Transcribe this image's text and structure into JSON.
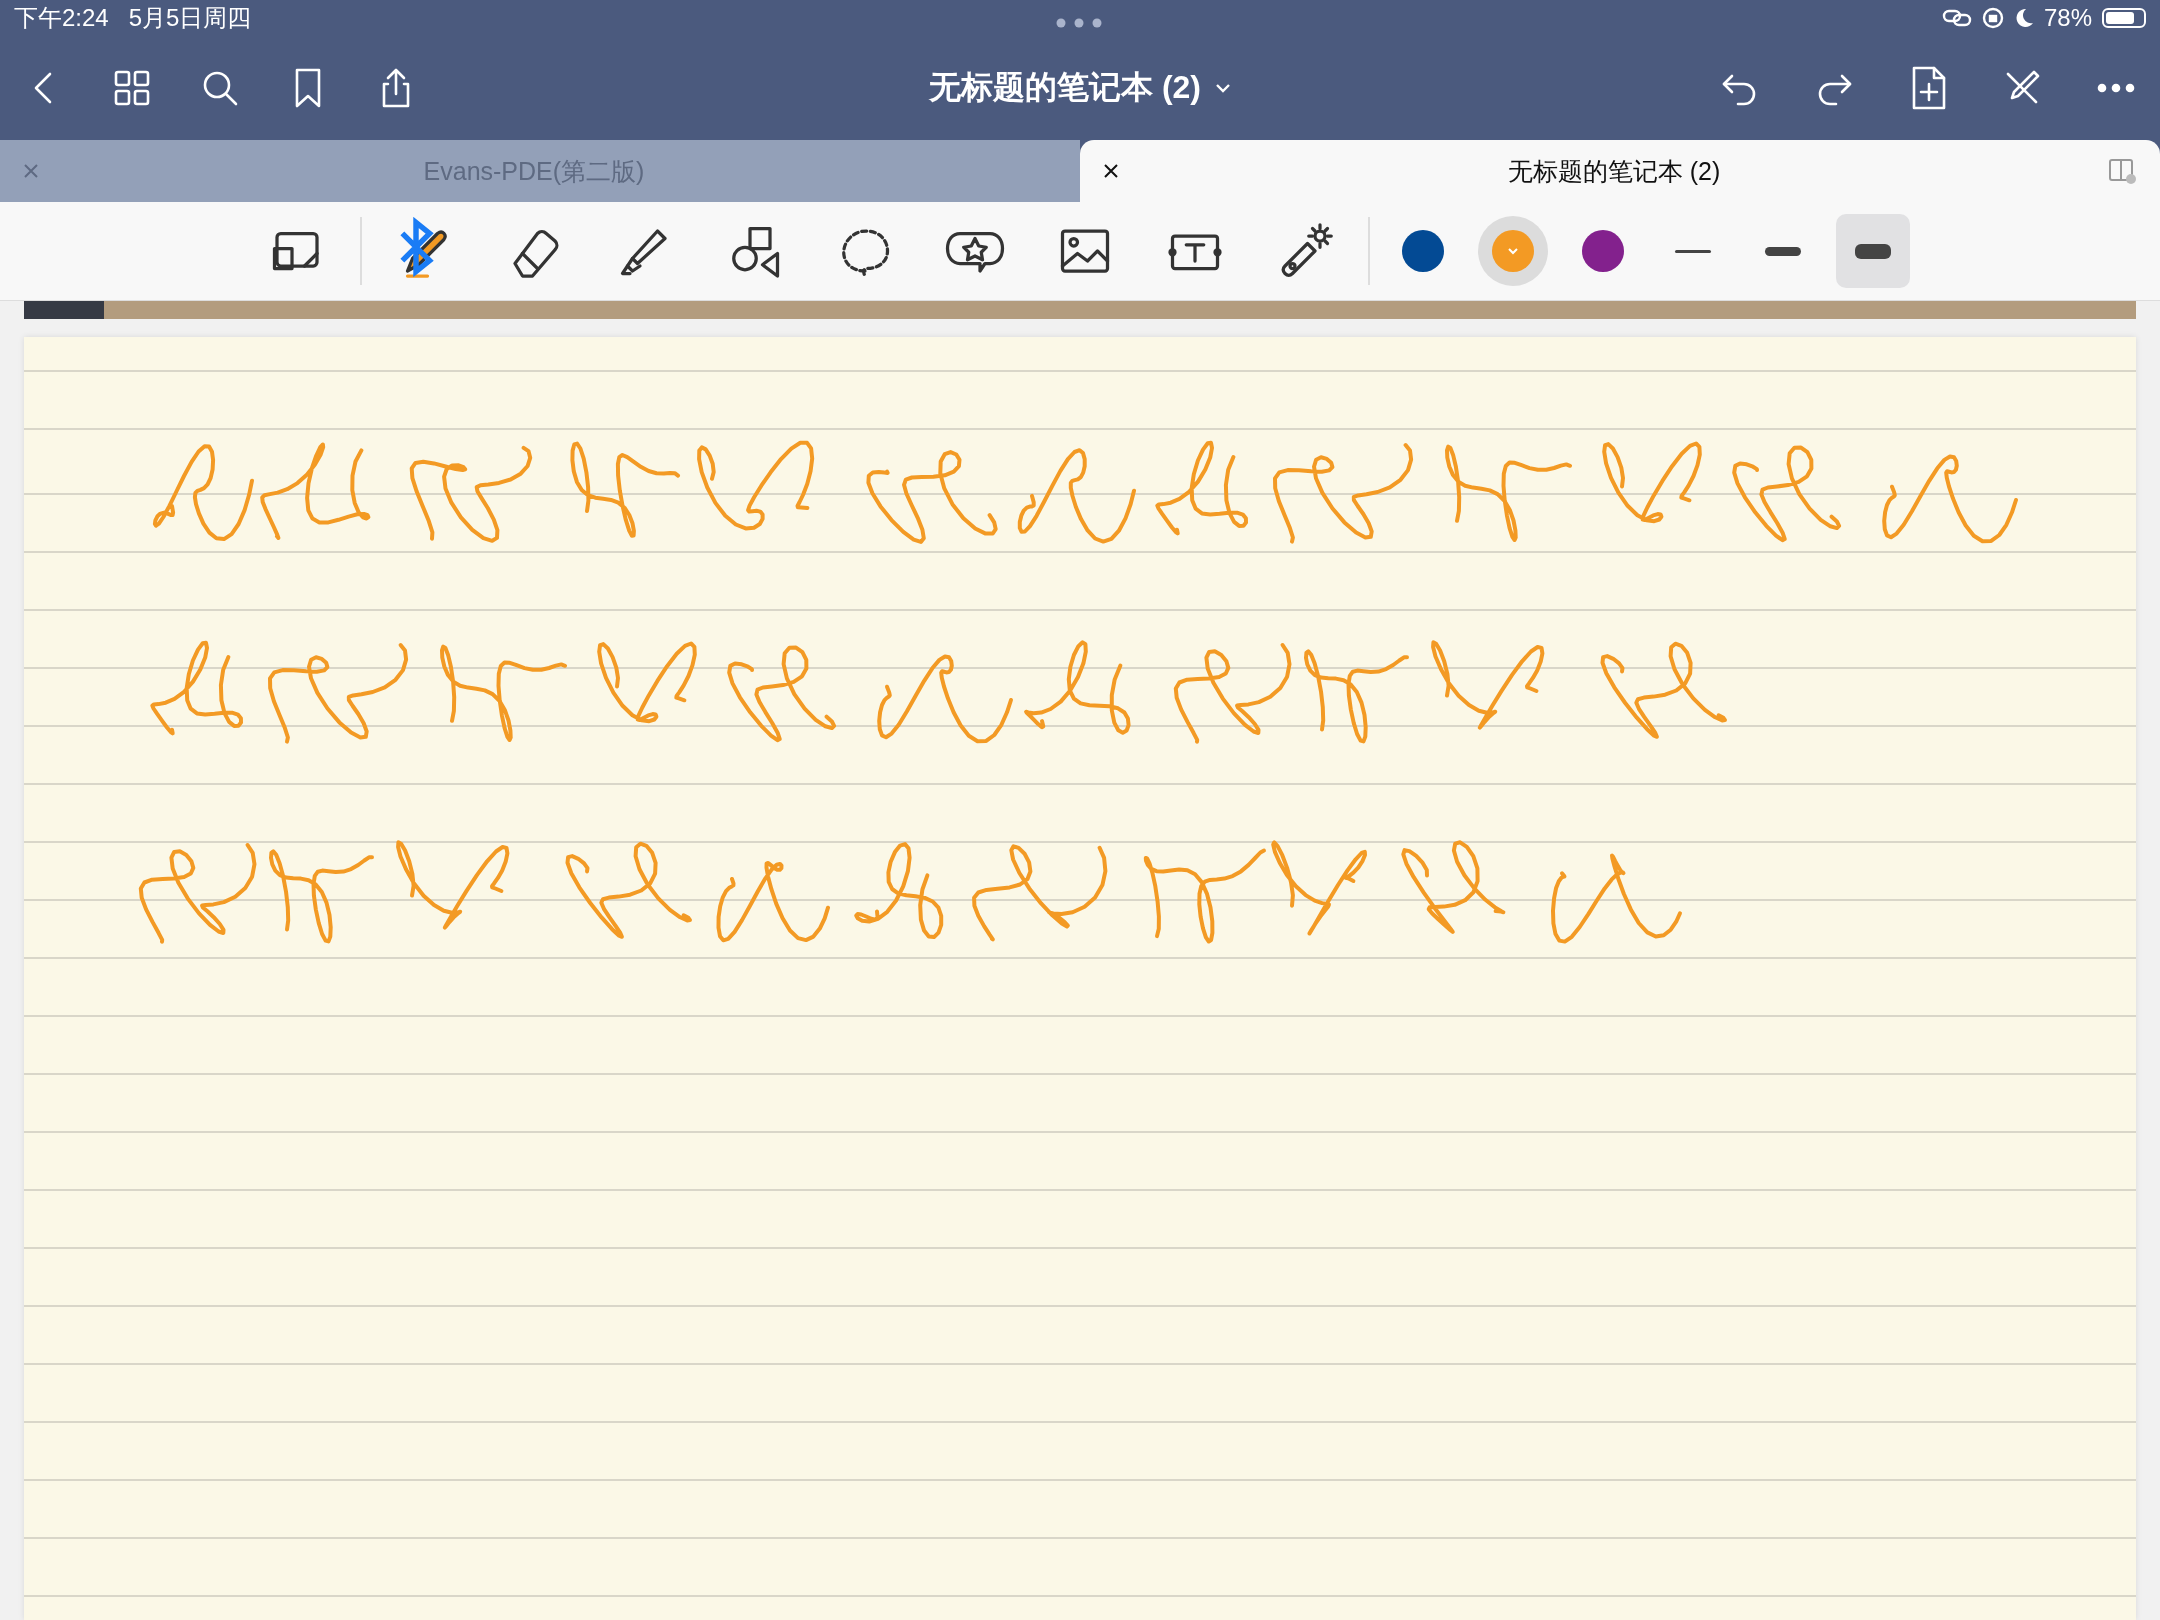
{
  "status_bar": {
    "time": "下午2:24",
    "date": "5月5日周四",
    "battery": "78%"
  },
  "nav": {
    "title": "无标题的笔记本 (2)"
  },
  "tabs": [
    {
      "label": "Evans-PDE(第二版)",
      "selected": false
    },
    {
      "label": "无标题的笔记本 (2)",
      "selected": true
    }
  ],
  "tools": [
    {
      "kind": "zoom",
      "selected": false
    },
    {
      "kind": "pen",
      "selected": true
    },
    {
      "kind": "eraser",
      "selected": false
    },
    {
      "kind": "highlighter",
      "selected": false
    },
    {
      "kind": "shapes",
      "selected": false
    },
    {
      "kind": "lasso",
      "selected": false
    },
    {
      "kind": "sticker",
      "selected": false
    },
    {
      "kind": "image",
      "selected": false
    },
    {
      "kind": "text",
      "selected": false
    },
    {
      "kind": "laser",
      "selected": false
    }
  ],
  "colors": [
    {
      "color": "#034a94",
      "selected": false
    },
    {
      "color": "#f39a24",
      "selected": true
    },
    {
      "color": "#83218d",
      "selected": false
    }
  ],
  "widths": [
    {
      "kind": "thin",
      "selected": false
    },
    {
      "kind": "medium",
      "selected": false
    },
    {
      "kind": "thick",
      "selected": true
    }
  ]
}
